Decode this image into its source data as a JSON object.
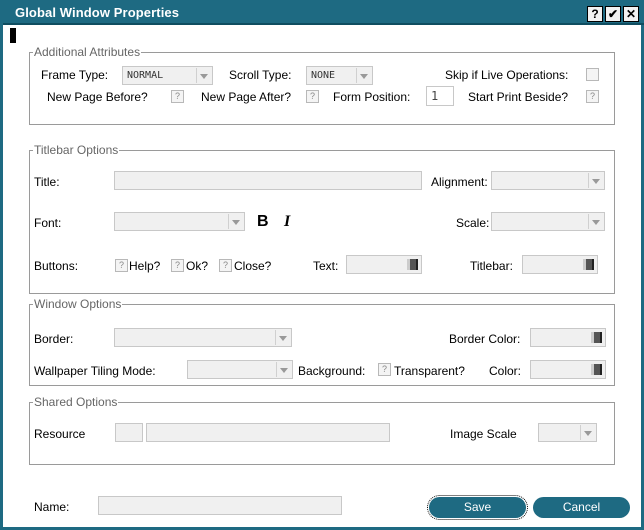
{
  "window": {
    "title": "Global Window Properties",
    "help_label": "?",
    "confirm_label": "✔",
    "close_label": "✕"
  },
  "additional": {
    "legend": "Additional Attributes",
    "frame_type_label": "Frame Type:",
    "frame_type_value": "NORMAL",
    "scroll_type_label": "Scroll Type:",
    "scroll_type_value": "NONE",
    "skip_live_label": "Skip if Live Operations:",
    "new_page_before_label": "New Page Before?",
    "new_page_after_label": "New Page After?",
    "form_position_label": "Form Position:",
    "form_position_value": "1",
    "start_print_label": "Start Print Beside?"
  },
  "titlebar_opts": {
    "legend": "Titlebar Options",
    "title_label": "Title:",
    "alignment_label": "Alignment:",
    "font_label": "Font:",
    "bold_label": "B",
    "italic_label": "I",
    "scale_label": "Scale:",
    "buttons_label": "Buttons:",
    "help_label": "Help?",
    "ok_label": "Ok?",
    "close_label": "Close?",
    "text_label": "Text:",
    "titlebar_label": "Titlebar:"
  },
  "window_opts": {
    "legend": "Window Options",
    "border_label": "Border:",
    "border_color_label": "Border Color:",
    "wallpaper_label": "Wallpaper Tiling Mode:",
    "background_label": "Background:",
    "transparent_label": "Transparent?",
    "color_label": "Color:"
  },
  "shared": {
    "legend": "Shared Options",
    "resource_label": "Resource",
    "image_scale_label": "Image Scale"
  },
  "footer": {
    "name_label": "Name:",
    "save_label": "Save",
    "cancel_label": "Cancel"
  },
  "checkbox_glyph": "?"
}
